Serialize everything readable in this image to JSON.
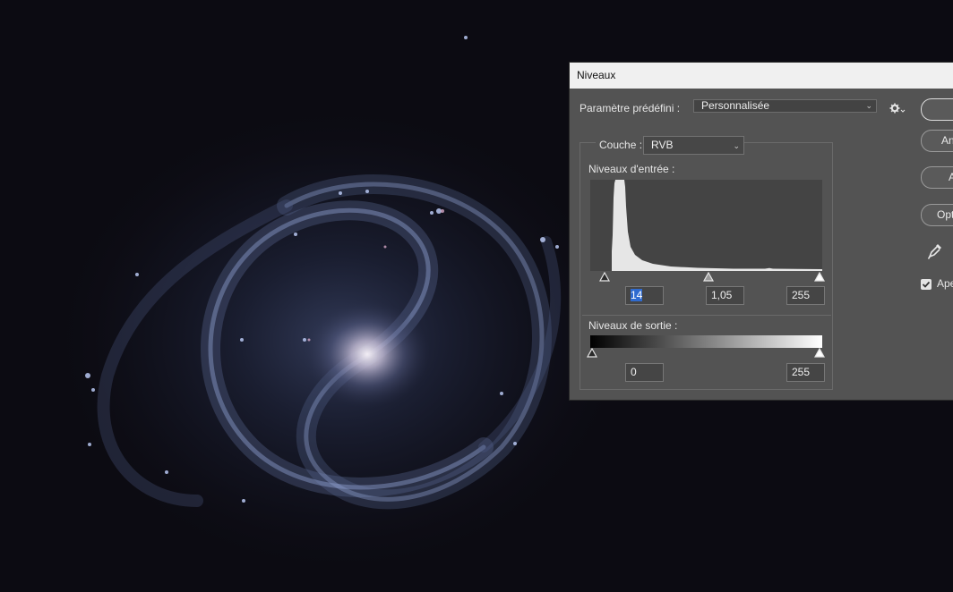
{
  "dialog": {
    "title": "Niveaux",
    "preset_label": "Paramètre prédéfini :",
    "preset_value": "Personnalisée",
    "channel_label": "Couche :",
    "channel_value": "RVB",
    "input_levels_label": "Niveaux d'entrée :",
    "output_levels_label": "Niveaux de sortie :",
    "input_black": "14",
    "input_gamma": "1,05",
    "input_white": "255",
    "output_black": "0",
    "output_white": "255",
    "buttons": {
      "ok": "",
      "reset": "An",
      "auto": "A",
      "options": "Opt"
    },
    "preview_label": "Ape",
    "preview_checked": true
  },
  "icons": {
    "preset_chevron": "chevron-down-icon",
    "channel_chevron": "chevron-down-icon",
    "gear": "gear-icon",
    "eyedropper": "eyedropper-icon",
    "black_point_slider": "triangle-slider-icon",
    "gamma_slider": "triangle-slider-icon",
    "white_point_slider": "triangle-slider-icon"
  },
  "colors": {
    "dialog_bg": "#535353",
    "titlebar_bg": "#f0f0f0",
    "selection": "#2f6bd0",
    "histogram_fill": "#e6e6e6"
  }
}
